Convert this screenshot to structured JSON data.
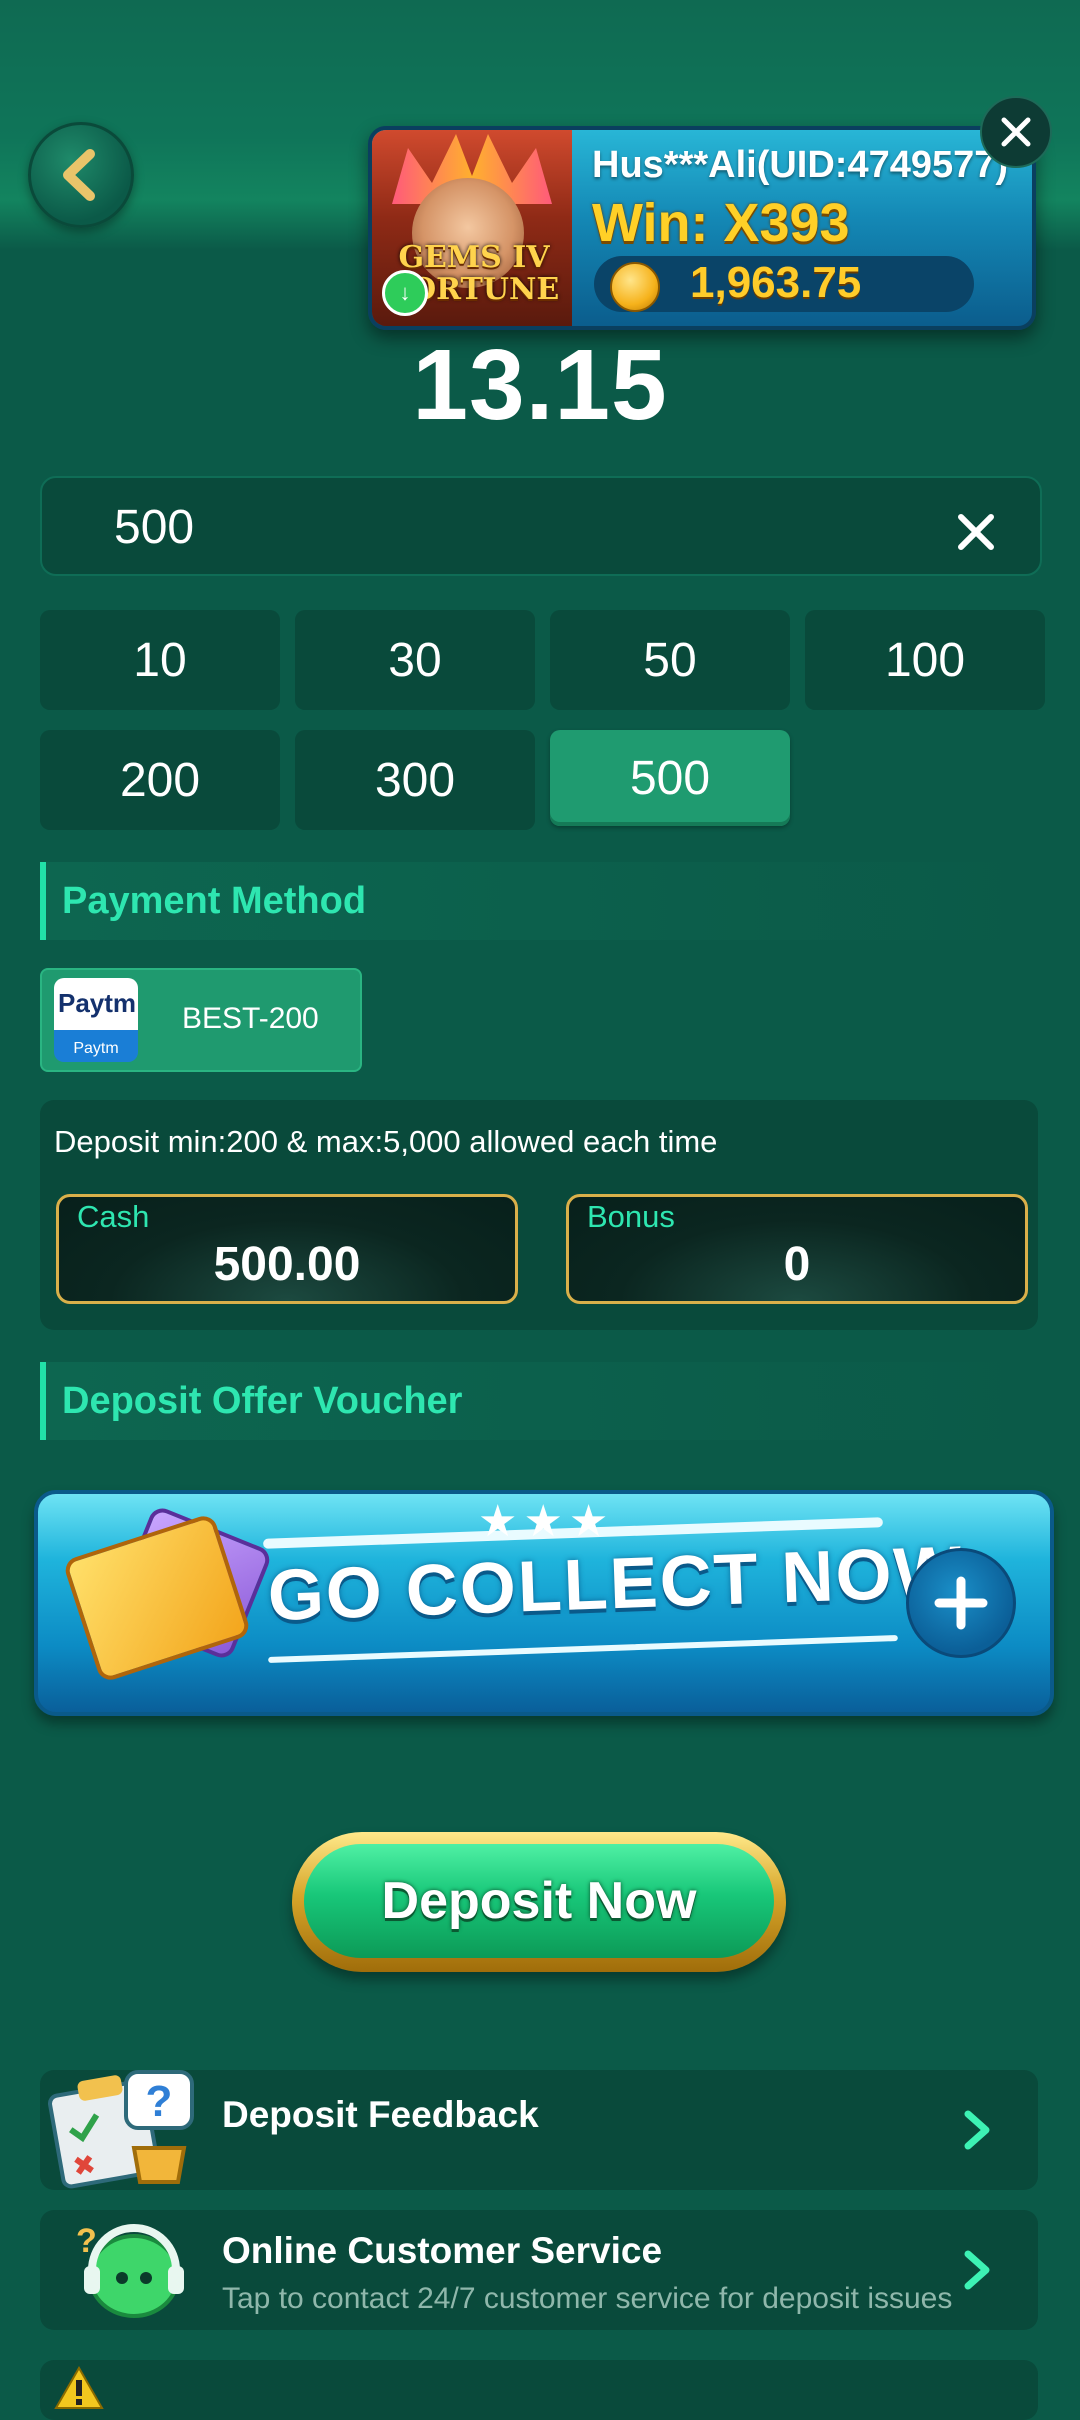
{
  "header": {
    "back_icon": "chevron-left-icon"
  },
  "win_toast": {
    "game_name": "GEMS IV FORTUNE",
    "user": "Hus***Ali(UID:4749577)",
    "win": "Win: X393",
    "amount": "1,963.75",
    "close_icon": "close-icon"
  },
  "balance": "13.15",
  "amount_input": {
    "value": "500",
    "clear_icon": "clear-icon"
  },
  "quick_amounts": [
    {
      "label": "10",
      "selected": false
    },
    {
      "label": "30",
      "selected": false
    },
    {
      "label": "50",
      "selected": false
    },
    {
      "label": "100",
      "selected": false
    },
    {
      "label": "200",
      "selected": false
    },
    {
      "label": "300",
      "selected": false
    },
    {
      "label": "500",
      "selected": true
    }
  ],
  "payment_method": {
    "title": "Payment Method",
    "option": {
      "logo_text": "Paytm",
      "logo_caption": "Paytm",
      "label": "BEST-200"
    }
  },
  "limits": {
    "text": "Deposit min:200 & max:5,000 allowed each time",
    "cash_label": "Cash",
    "cash_value": "500.00",
    "bonus_label": "Bonus",
    "bonus_value": "0"
  },
  "voucher": {
    "title": "Deposit Offer Voucher",
    "banner_text": "GO COLLECT NOW",
    "stars": "★★★"
  },
  "deposit_button": "Deposit Now",
  "list": [
    {
      "title": "Deposit Feedback",
      "subtitle": ""
    },
    {
      "title": "Online Customer Service",
      "subtitle": "Tap to contact 24/7 customer service for deposit issues"
    }
  ],
  "colors": {
    "background": "#0b5a48",
    "panel": "#094a3b",
    "accent": "#2ee6b0",
    "selected_chip": "#1f9b70",
    "gold": "#d9b04a"
  }
}
